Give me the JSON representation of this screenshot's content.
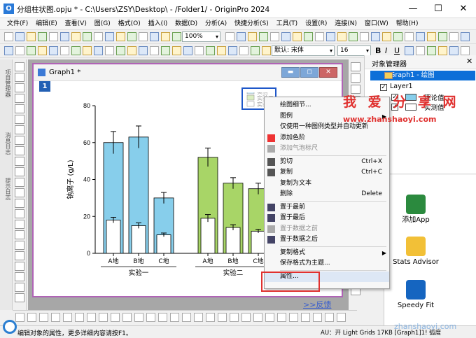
{
  "window": {
    "title": "分组柱状图.opju * - C:\\Users\\ZSY\\Desktop\\ - /Folder1/ - OriginPro 2024",
    "controls": [
      "—",
      "☐",
      "✕"
    ]
  },
  "menubar": [
    "文件(F)",
    "编辑(E)",
    "查看(V)",
    "图(G)",
    "格式(O)",
    "插入(I)",
    "数据(D)",
    "分析(A)",
    "快捷分析(S)",
    "工具(T)",
    "设置(R)",
    "连接(N)",
    "窗口(W)",
    "帮助(H)"
  ],
  "toolbar": {
    "zoom": "100%",
    "font_name": "默认: 宋体",
    "font_size": "16",
    "bold": "B",
    "italic": "I",
    "underline": "U"
  },
  "left_strip_tabs": [
    "项目管理器",
    "消息日志",
    "提示日志"
  ],
  "graph_window": {
    "title": "Graph1 *",
    "layer_number": "1"
  },
  "chart_data": {
    "type": "bar",
    "ylabel": "钠离子 (g/L)",
    "ylim": [
      0,
      80
    ],
    "yticks": [
      "0",
      "20",
      "40",
      "60",
      "80"
    ],
    "groups": [
      {
        "name": "实验一",
        "categories": [
          "A地",
          "B地",
          "C地"
        ]
      },
      {
        "name": "实验二",
        "categories": [
          "A地",
          "B地",
          "C地"
        ]
      }
    ],
    "series": [
      {
        "name": "理论值",
        "color": "#87ceeb",
        "values": [
          60,
          63,
          30,
          52,
          38,
          35
        ],
        "errors": [
          6,
          6,
          3,
          5,
          3,
          3
        ]
      },
      {
        "name": "实测值",
        "color": "#c5e57d",
        "values": [
          18,
          15,
          10,
          19,
          14,
          12
        ],
        "errors": [
          1.5,
          1.5,
          1,
          2,
          1.5,
          1
        ]
      }
    ],
    "group2_color": "#a8d567",
    "legend": [
      "实验一",
      "实验二",
      "实验"
    ]
  },
  "feedback_link": ">>反馈",
  "context_menu": {
    "items": [
      {
        "label": "绘图细节...",
        "shortcut": "",
        "disabled": false,
        "submenu": false
      },
      {
        "label": "图例",
        "shortcut": "",
        "disabled": false,
        "submenu": true
      },
      {
        "label": "仅使用一种图例类型并自动更新",
        "shortcut": "",
        "disabled": false,
        "submenu": false
      },
      {
        "label": "添加色阶",
        "shortcut": "",
        "disabled": false,
        "submenu": false
      },
      {
        "label": "添加气泡标尺",
        "shortcut": "",
        "disabled": true,
        "submenu": false
      },
      {
        "label": "剪切",
        "shortcut": "Ctrl+X",
        "disabled": false,
        "submenu": false
      },
      {
        "label": "复制",
        "shortcut": "Ctrl+C",
        "disabled": false,
        "submenu": false
      },
      {
        "label": "复制为文本",
        "shortcut": "",
        "disabled": false,
        "submenu": false
      },
      {
        "label": "删除",
        "shortcut": "Delete",
        "disabled": false,
        "submenu": false
      },
      {
        "label": "置于最前",
        "shortcut": "",
        "disabled": false,
        "submenu": false
      },
      {
        "label": "置于最后",
        "shortcut": "",
        "disabled": false,
        "submenu": false
      },
      {
        "label": "置于数据之前",
        "shortcut": "",
        "disabled": true,
        "submenu": false
      },
      {
        "label": "置于数据之后",
        "shortcut": "",
        "disabled": false,
        "submenu": false
      },
      {
        "label": "复制格式",
        "shortcut": "",
        "disabled": false,
        "submenu": true
      },
      {
        "label": "保存格式为主题...",
        "shortcut": "",
        "disabled": false,
        "submenu": false
      },
      {
        "label": "属性...",
        "shortcut": "",
        "disabled": false,
        "submenu": false
      }
    ]
  },
  "object_manager": {
    "title": "对象管理器",
    "graph_label": "Graph1 - 绘图",
    "layer_label": "Layer1",
    "series": [
      "理论值",
      "实测值"
    ]
  },
  "apps": [
    {
      "label": "添加App"
    },
    {
      "label": "Stats Advisor"
    },
    {
      "label": "Speedy Fit"
    }
  ],
  "watermark": {
    "line1": "我 爱 分 享 网",
    "line2": "www.zhanshaoyi.com",
    "line3": "zhanshaoyi.com"
  },
  "statusbar": {
    "text": "编辑对象的属性，更多详细内容请按F1。",
    "right": "AU：开   Light Grids   17KB   [Graph1]1!   弧度"
  }
}
